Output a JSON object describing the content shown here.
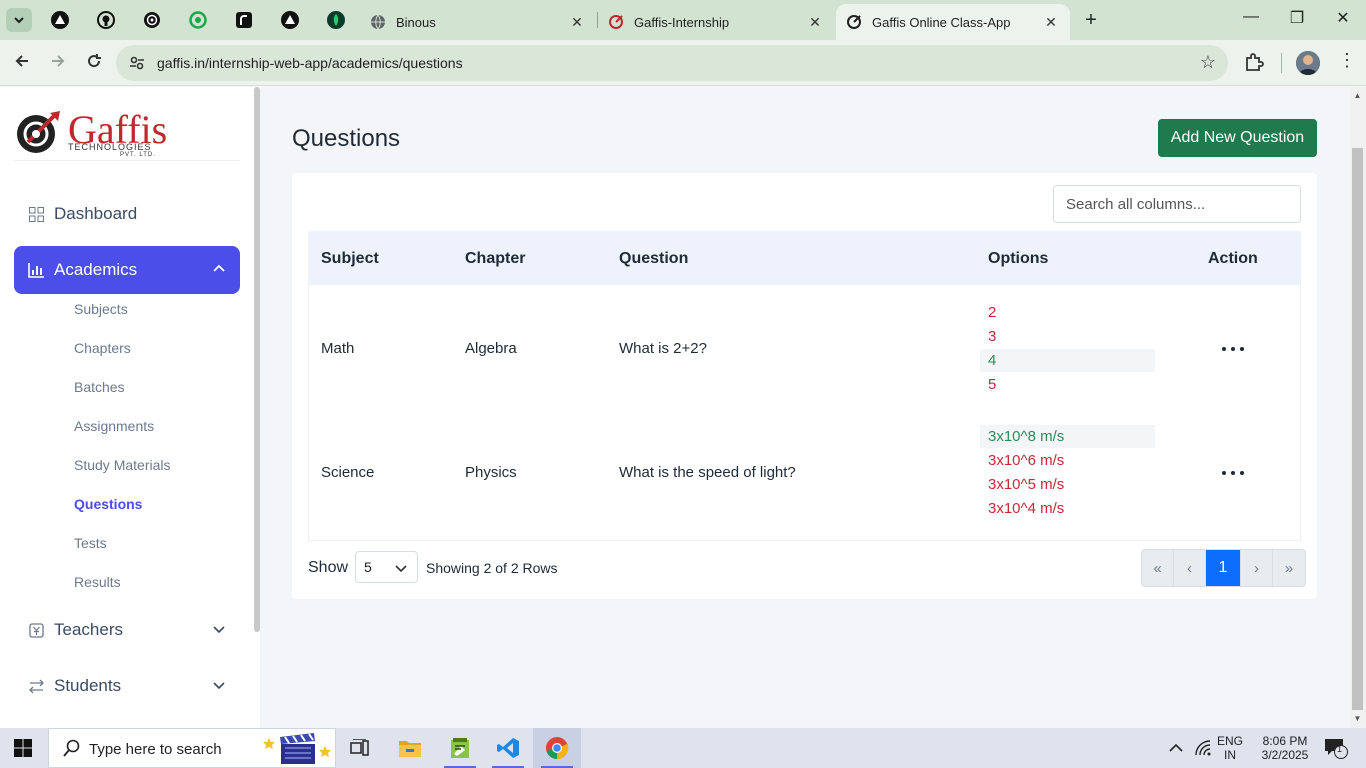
{
  "browser": {
    "tabs": [
      {
        "label": "Binous",
        "close": "✕"
      },
      {
        "label": "Gaffis-Internship",
        "close": "✕"
      },
      {
        "label": "Gaffis Online Class-App",
        "close": "✕"
      }
    ],
    "new_tab": "+",
    "url": "gaffis.in/internship-web-app/academics/questions",
    "window_controls": {
      "minimize": "—",
      "maximize": "❐",
      "close": "✕"
    }
  },
  "logo": {
    "word": "Gaffis",
    "line1": "TECHNOLOGIES",
    "line2": "PVT. LTD."
  },
  "sidebar": {
    "dashboard": "Dashboard",
    "academics": "Academics",
    "academics_sub": [
      "Subjects",
      "Chapters",
      "Batches",
      "Assignments",
      "Study Materials",
      "Questions",
      "Tests",
      "Results"
    ],
    "teachers": "Teachers",
    "students": "Students"
  },
  "page": {
    "title": "Questions",
    "add_button": "Add New Question",
    "search_placeholder": "Search all columns..."
  },
  "table": {
    "headers": [
      "Subject",
      "Chapter",
      "Question",
      "Options",
      "Action"
    ],
    "rows": [
      {
        "subject": "Math",
        "chapter": "Algebra",
        "question": "What is 2+2?",
        "options": [
          "2",
          "3",
          "4",
          "5"
        ],
        "correct_index": 2
      },
      {
        "subject": "Science",
        "chapter": "Physics",
        "question": "What is the speed of light?",
        "options": [
          "3x10^8 m/s",
          "3x10^6 m/s",
          "3x10^5 m/s",
          "3x10^4 m/s"
        ],
        "correct_index": 0
      }
    ]
  },
  "footer": {
    "show_label": "Show",
    "page_size": "5",
    "rows_info": "Showing 2 of 2 Rows",
    "pager": {
      "first": "«",
      "prev": "‹",
      "current": "1",
      "next": "›",
      "last": "»"
    }
  },
  "taskbar": {
    "search_text": "Type here to search",
    "lang1": "ENG",
    "lang2": "IN",
    "time": "8:06 PM",
    "date": "3/2/2025",
    "notifications": "1"
  },
  "colors": {
    "accent": "#4b4ee8",
    "add_button": "#1f7a4d",
    "correct": "#2f8a5a",
    "wrong": "#c8283a",
    "pager_active": "#0d6efd"
  }
}
